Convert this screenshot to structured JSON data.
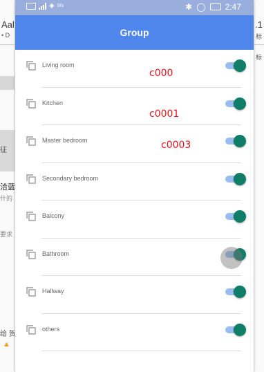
{
  "status_bar": {
    "net_speed": "0/s",
    "time": "2:47"
  },
  "header": {
    "title": "Group"
  },
  "background_app": {
    "left_snippets": [
      "Aal",
      "• D",
      "征",
      "洽蓝",
      "什的",
      "要求",
      "给 贺"
    ],
    "right_snippets": [
      ".1",
      "标",
      "标"
    ]
  },
  "groups": [
    {
      "label": "Living room",
      "enabled": true,
      "icon": "copy-icon"
    },
    {
      "label": "Kitchen",
      "enabled": true,
      "icon": "copy-icon"
    },
    {
      "label": "Master bedroom",
      "enabled": true,
      "icon": "copy-icon"
    },
    {
      "label": "Secondary bedroom",
      "enabled": true,
      "icon": "copy-icon"
    },
    {
      "label": "Balcony",
      "enabled": true,
      "icon": "copy-icon"
    },
    {
      "label": "Bathroom",
      "enabled": true,
      "icon": "copy-icon"
    },
    {
      "label": "Hallway",
      "enabled": true,
      "icon": "copy-icon"
    },
    {
      "label": "others",
      "enabled": true,
      "icon": "copy-icon"
    }
  ],
  "annotations": [
    "c000",
    "c0001",
    "c0003"
  ],
  "colors": {
    "header": "#4f86ec",
    "status_bar": "#9aaede",
    "switch_thumb": "#0f7d68",
    "switch_track": "#9bbcef",
    "annotation": "#e4141e"
  }
}
